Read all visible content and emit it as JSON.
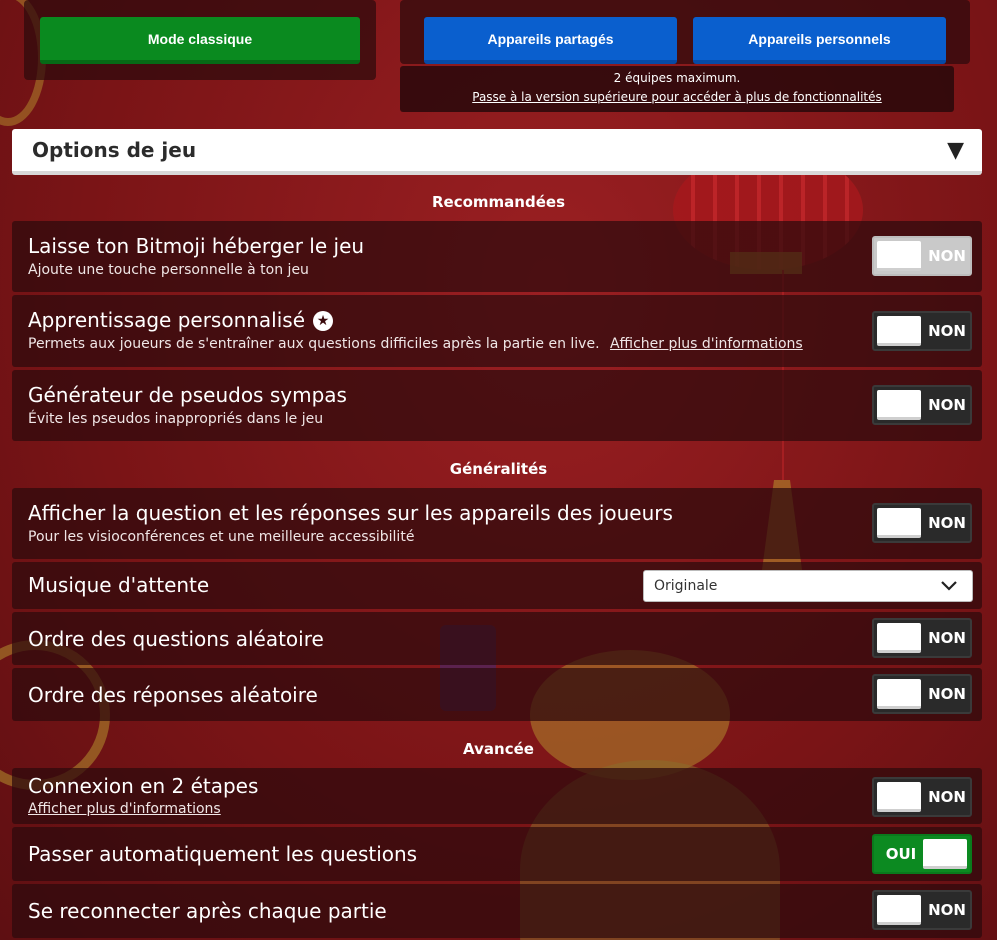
{
  "mode": {
    "classic_label": "Mode classique",
    "shared_devices_label": "Appareils partagés",
    "personal_devices_label": "Appareils personnels",
    "max_teams_text": "2 équipes maximum.",
    "upgrade_link": "Passe à la version supérieure pour accéder à plus de fonctionnalités"
  },
  "options": {
    "header_title": "Options de jeu",
    "header_icon": "collapse-triangle-icon"
  },
  "sections": {
    "recommended": "Recommandées",
    "general": "Généralités",
    "advanced": "Avancée"
  },
  "settings": {
    "bitmoji": {
      "label": "Laisse ton Bitmoji héberger le jeu",
      "desc": "Ajoute une touche personnelle à ton jeu",
      "toggle": "NON"
    },
    "personalized": {
      "label": "Apprentissage personnalisé",
      "desc": "Permets aux joueurs de s'entraîner aux questions difficiles après la partie en live.",
      "link": "Afficher plus d'informations",
      "toggle": "NON",
      "icon": "star-icon"
    },
    "nicknames": {
      "label": "Générateur de pseudos sympas",
      "desc": "Évite les pseudos inappropriés dans le jeu",
      "toggle": "NON"
    },
    "show_question": {
      "label": "Afficher la question et les réponses sur les appareils des joueurs",
      "desc": "Pour les visioconférences et une meilleure accessibilité",
      "toggle": "NON"
    },
    "lobby_music": {
      "label": "Musique d'attente",
      "value": "Originale"
    },
    "random_questions": {
      "label": "Ordre des questions aléatoire",
      "toggle": "NON"
    },
    "random_answers": {
      "label": "Ordre des réponses aléatoire",
      "toggle": "NON"
    },
    "two_step": {
      "label": "Connexion en 2 étapes",
      "link": "Afficher plus d'informations",
      "toggle": "NON"
    },
    "auto_advance": {
      "label": "Passer automatiquement les questions",
      "toggle": "OUI"
    },
    "reconnect": {
      "label": "Se reconnecter après chaque partie",
      "toggle": "NON"
    }
  },
  "colors": {
    "accent_green": "#0a8a1f",
    "accent_blue": "#0a5fce",
    "background": "#7d1518"
  }
}
